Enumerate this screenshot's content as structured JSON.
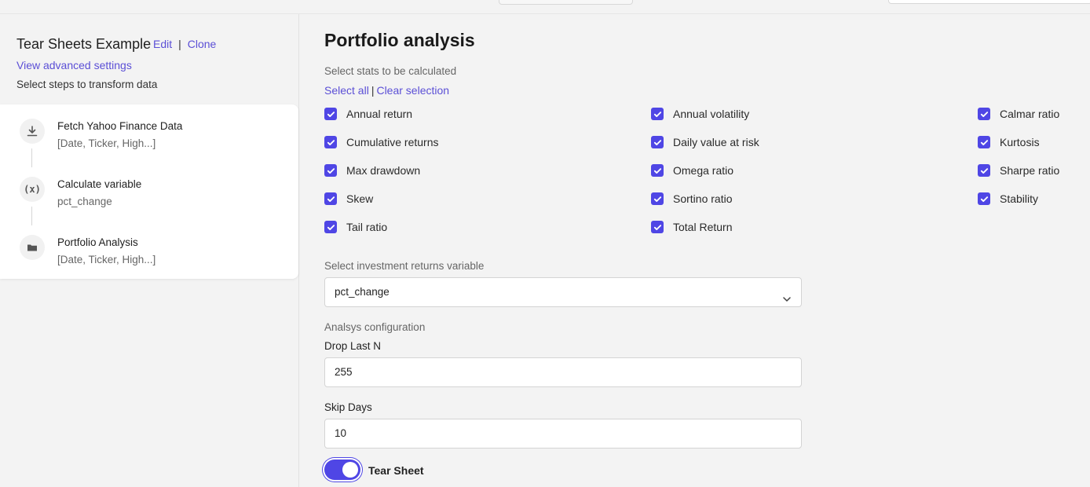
{
  "workflow": {
    "title": "Tear Sheets Example",
    "edit_label": "Edit",
    "clone_label": "Clone",
    "advanced_label": "View advanced settings",
    "steps_hint": "Select steps to transform data"
  },
  "steps": [
    {
      "title": "Fetch Yahoo Finance Data",
      "subtitle": "[Date, Ticker, High...]",
      "icon": "download-icon"
    },
    {
      "title": "Calculate variable",
      "subtitle": "pct_change",
      "icon": "function-icon",
      "glyph": "(x)"
    },
    {
      "title": "Portfolio Analysis",
      "subtitle": "[Date, Ticker, High...]",
      "icon": "folder-icon"
    }
  ],
  "main": {
    "title": "Portfolio analysis",
    "stats_label": "Select stats to be calculated",
    "select_all": "Select all",
    "separator": "|",
    "clear_selection": "Clear selection",
    "stats": [
      {
        "label": "Annual return",
        "checked": true
      },
      {
        "label": "Annual volatility",
        "checked": true
      },
      {
        "label": "Calmar ratio",
        "checked": true
      },
      {
        "label": "Cumulative returns",
        "checked": true
      },
      {
        "label": "Daily value at risk",
        "checked": true
      },
      {
        "label": "Kurtosis",
        "checked": true
      },
      {
        "label": "Max drawdown",
        "checked": true
      },
      {
        "label": "Omega ratio",
        "checked": true
      },
      {
        "label": "Sharpe ratio",
        "checked": true
      },
      {
        "label": "Skew",
        "checked": true
      },
      {
        "label": "Sortino ratio",
        "checked": true
      },
      {
        "label": "Stability",
        "checked": true
      },
      {
        "label": "Tail ratio",
        "checked": true
      },
      {
        "label": "Total Return",
        "checked": true
      }
    ],
    "returns_label": "Select investment returns variable",
    "returns_value": "pct_change",
    "config_label": "Analsys configuration",
    "drop_last_label": "Drop Last N",
    "drop_last_value": "255",
    "skip_days_label": "Skip Days",
    "skip_days_value": "10",
    "tear_sheet_label": "Tear Sheet",
    "tear_sheet_on": true
  },
  "colors": {
    "accent": "#4f46e5",
    "link": "#5b4fd6"
  }
}
